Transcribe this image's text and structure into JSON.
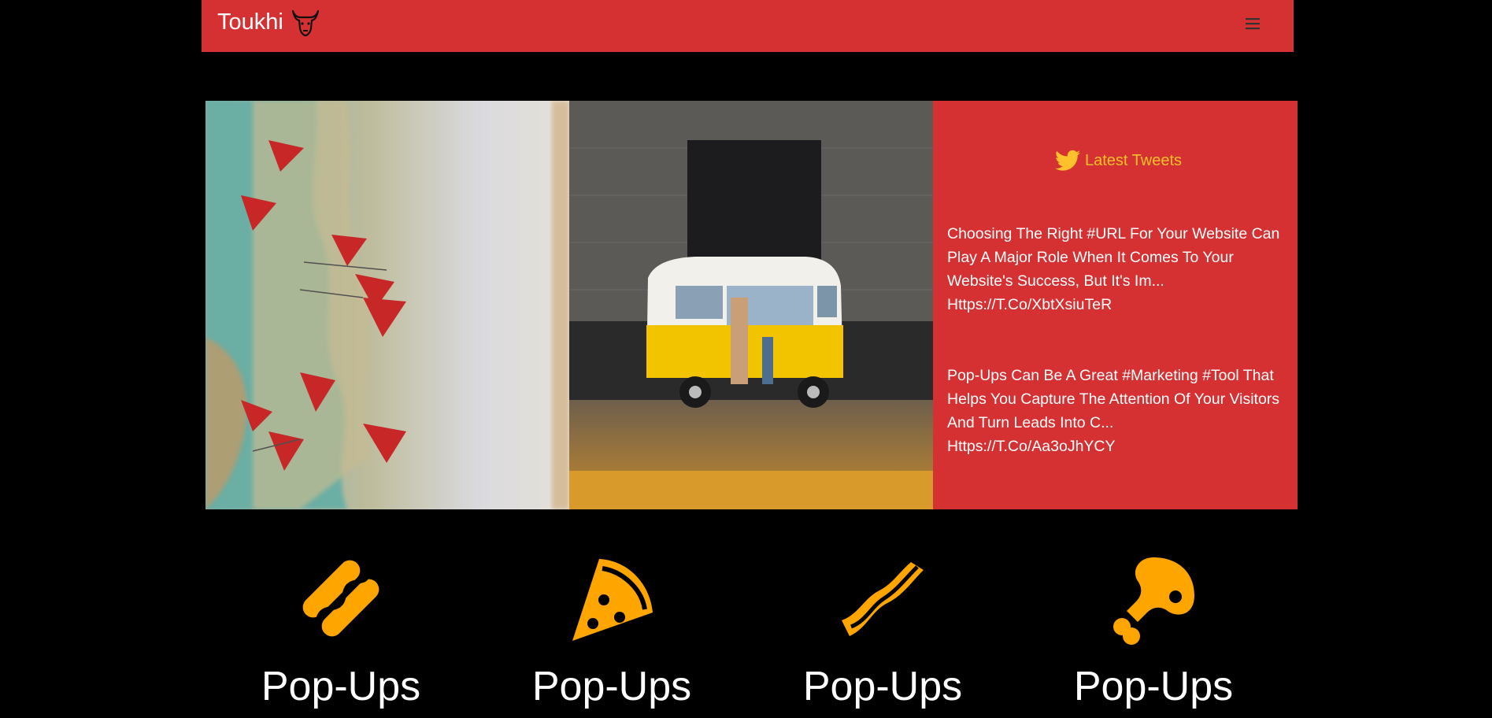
{
  "navbar": {
    "brand": "Toukhi",
    "brand_icon": "bull-head-icon",
    "menu_icon": "hamburger-icon",
    "background": "#d53032"
  },
  "hero": {
    "photos": [
      {
        "icon": "map-with-pins-photo"
      },
      {
        "icon": "yellow-van-photo"
      }
    ],
    "tweets_panel": {
      "heading": "Latest Tweets",
      "heading_icon": "twitter-icon",
      "heading_color": "#ffc12b",
      "tweets": [
        {
          "text": "Choosing The Right #URL For Your Website Can Play A Major Role When It Comes To Your Website's Success, But It's Im...",
          "link": "Https://T.Co/XbtXsiuTeR"
        },
        {
          "text": "Pop-Ups Can Be A Great #Marketing #Tool That Helps You Capture The Attention Of Your Visitors And Turn Leads Into C...",
          "link": "Https://T.Co/Aa3oJhYCY"
        }
      ]
    }
  },
  "features": [
    {
      "icon": "hotdog-icon",
      "title": "Pop-Ups"
    },
    {
      "icon": "pizza-slice-icon",
      "title": "Pop-Ups"
    },
    {
      "icon": "bacon-icon",
      "title": "Pop-Ups"
    },
    {
      "icon": "drumstick-icon",
      "title": "Pop-Ups"
    }
  ],
  "colors": {
    "accent": "#d53032",
    "icon_orange": "#ffa500",
    "background": "#000000"
  }
}
